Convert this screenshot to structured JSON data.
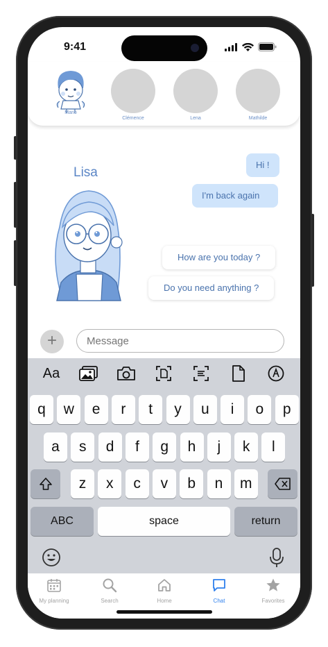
{
  "status": {
    "time": "9:41"
  },
  "stories": [
    {
      "name": "Mario"
    },
    {
      "name": "Clémence"
    },
    {
      "name": "Lena"
    },
    {
      "name": "Mathilde"
    }
  ],
  "chat": {
    "contact_name": "Lisa",
    "received": [
      "Hi !",
      "I'm back again"
    ],
    "replies": [
      "How are you today ?",
      "Do you need anything ?"
    ]
  },
  "composer": {
    "placeholder": "Message",
    "add_label": "+"
  },
  "keyboard": {
    "toolbar_text": "Aa",
    "row1": [
      "q",
      "w",
      "e",
      "r",
      "t",
      "y",
      "u",
      "i",
      "o",
      "p"
    ],
    "row2": [
      "a",
      "s",
      "d",
      "f",
      "g",
      "h",
      "j",
      "k",
      "l"
    ],
    "row3": [
      "z",
      "x",
      "c",
      "v",
      "b",
      "n",
      "m"
    ],
    "abc": "ABC",
    "space": "space",
    "return": "return"
  },
  "tabs": [
    {
      "label": "My planning",
      "icon": "calendar-icon"
    },
    {
      "label": "Search",
      "icon": "search-icon"
    },
    {
      "label": "Home",
      "icon": "home-icon"
    },
    {
      "label": "Chat",
      "icon": "chat-icon",
      "active": true
    },
    {
      "label": "Favorites",
      "icon": "star-icon"
    }
  ],
  "colors": {
    "accent": "#2f80ed",
    "bubble": "#cfe4fb",
    "avatar_blue": "#6f9ad6"
  }
}
